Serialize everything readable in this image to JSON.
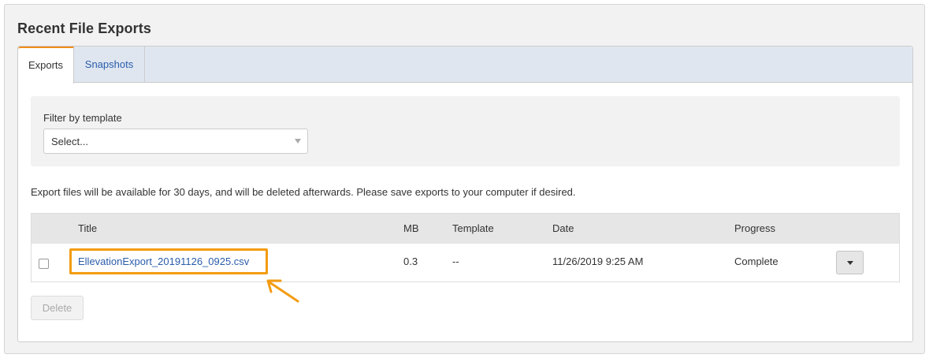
{
  "title": "Recent File Exports",
  "tabs": [
    {
      "label": "Exports",
      "active": true
    },
    {
      "label": "Snapshots",
      "active": false
    }
  ],
  "filter": {
    "label": "Filter by template",
    "selected": "Select..."
  },
  "notice": "Export files will be available for 30 days, and will be deleted afterwards. Please save exports to your computer if desired.",
  "table": {
    "columns": [
      "Title",
      "MB",
      "Template",
      "Date",
      "Progress"
    ],
    "rows": [
      {
        "title": "EllevationExport_20191126_0925.csv",
        "mb": "0.3",
        "template": "--",
        "date": "11/26/2019 9:25 AM",
        "progress": "Complete"
      }
    ]
  },
  "actions": {
    "delete_label": "Delete"
  },
  "colors": {
    "accent": "#f08c1a",
    "link": "#2a5caa",
    "highlight": "#f39c12"
  },
  "icons": {
    "select_arrow": "chevron-down-icon",
    "row_menu": "caret-down-icon",
    "annotation": "arrow-icon"
  }
}
